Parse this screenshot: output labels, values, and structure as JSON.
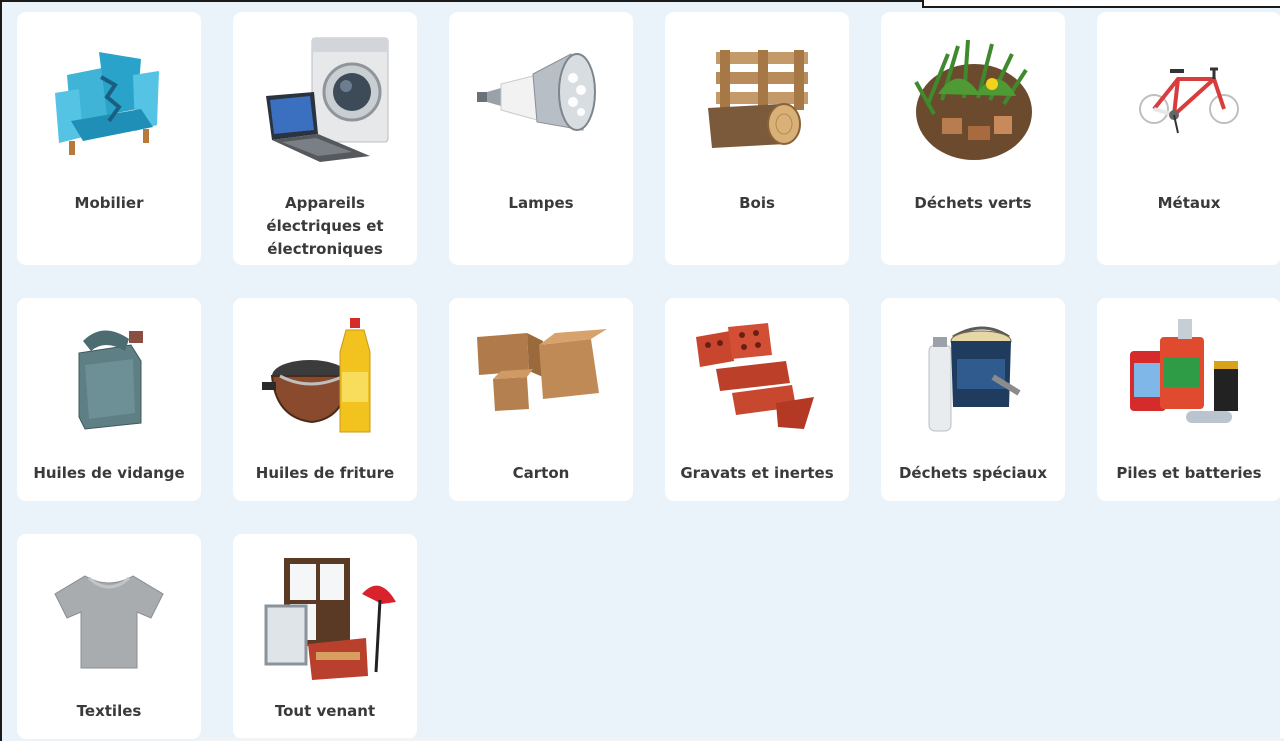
{
  "categories": [
    {
      "label": "Mobilier",
      "icon": "armchair-icon"
    },
    {
      "label": "Appareils\nélectriques et\nélectroniques",
      "icon": "appliances-icon"
    },
    {
      "label": "Lampes",
      "icon": "led-bulb-icon"
    },
    {
      "label": "Bois",
      "icon": "wood-pallet-icon"
    },
    {
      "label": "Déchets verts",
      "icon": "green-waste-icon"
    },
    {
      "label": "Métaux",
      "icon": "bicycle-icon"
    },
    {
      "label": "Huiles de vidange",
      "icon": "oil-jerrycan-icon"
    },
    {
      "label": "Huiles de friture",
      "icon": "frying-oil-icon"
    },
    {
      "label": "Carton",
      "icon": "cardboard-boxes-icon"
    },
    {
      "label": "Gravats et inertes",
      "icon": "bricks-icon"
    },
    {
      "label": "Déchets spéciaux",
      "icon": "paint-can-icon"
    },
    {
      "label": "Piles et batteries",
      "icon": "batteries-icon"
    },
    {
      "label": "Textiles",
      "icon": "tshirt-icon"
    },
    {
      "label": "Tout venant",
      "icon": "bulky-items-icon"
    }
  ]
}
